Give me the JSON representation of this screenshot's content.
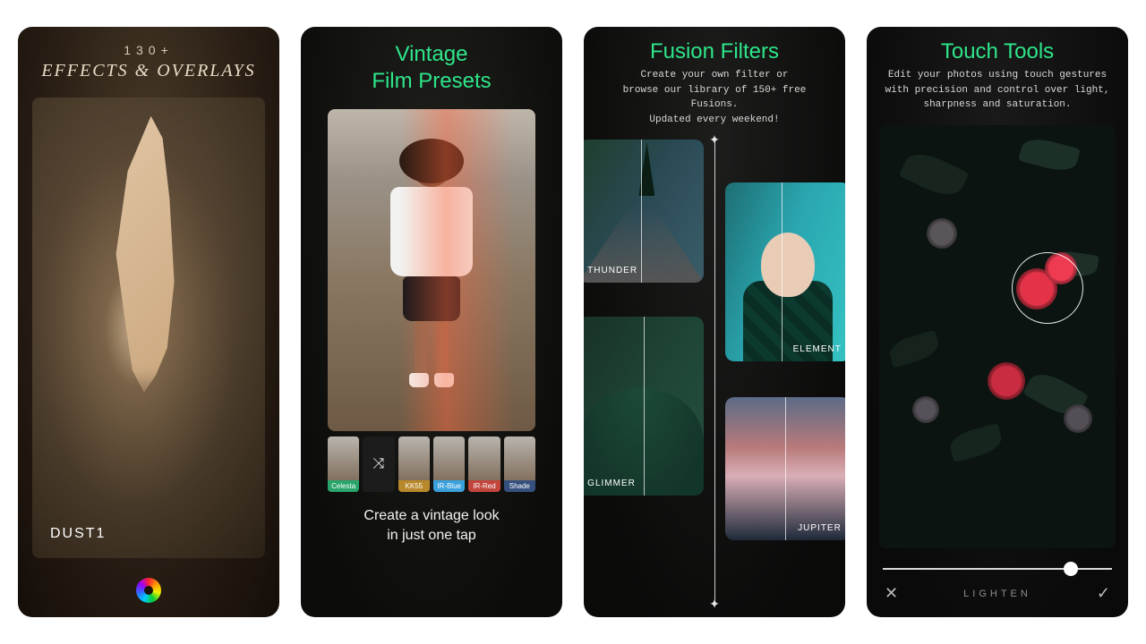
{
  "panel1": {
    "pretitle": "130+",
    "title": "EFFECTS & OVERLAYS",
    "effect_label": "DUST1"
  },
  "panel2": {
    "title": "Vintage\nFilm Presets",
    "caption": "Create a vintage look\nin just one tap",
    "shuffle_glyph": "⤨",
    "thumbs": [
      {
        "label": "Celesta",
        "color": "#2aa56a"
      },
      {
        "label": "",
        "color": "#1e1e1e"
      },
      {
        "label": "KK55",
        "color": "#b8892b"
      },
      {
        "label": "IR-Blue",
        "color": "#3aa0dc"
      },
      {
        "label": "IR-Red",
        "color": "#c2453c"
      },
      {
        "label": "Shade",
        "color": "#36507e"
      }
    ]
  },
  "panel3": {
    "title": "Fusion Filters",
    "subtitle": "Create your own filter or\nbrowse our library of 150+ free Fusions.\nUpdated every weekend!",
    "cards": {
      "thunder": "THUNDER",
      "element": "ELEMENT",
      "glimmer": "GLIMMER",
      "jupiter": "JUPITER"
    }
  },
  "panel4": {
    "title": "Touch Tools",
    "subtitle": "Edit your photos using touch gestures\nwith precision and control over light,\nsharpness and saturation.",
    "mode_label": "LIGHTEN",
    "cancel_glyph": "✕",
    "confirm_glyph": "✓",
    "slider_value": 82
  },
  "accent": "#2ee68a"
}
